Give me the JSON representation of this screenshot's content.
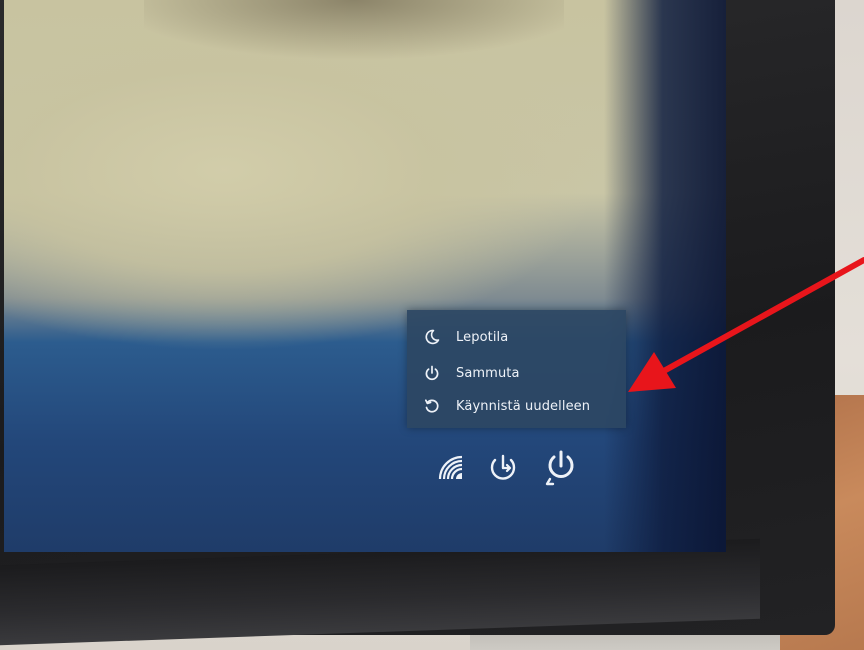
{
  "power_menu": {
    "items": [
      {
        "label": "Lepotila",
        "icon": "sleep-moon-icon"
      },
      {
        "label": "Sammuta",
        "icon": "shutdown-icon"
      },
      {
        "label": "Käynnistä uudelleen",
        "icon": "restart-icon"
      }
    ]
  },
  "tray": {
    "icons": [
      "network-icon",
      "ease-of-access-icon",
      "power-icon"
    ]
  },
  "annotation": {
    "arrow_color": "#e8151b",
    "points_to": "Käynnistä uudelleen"
  },
  "colors": {
    "menu_bg": "#2c4663",
    "menu_text": "#eef2f8"
  }
}
